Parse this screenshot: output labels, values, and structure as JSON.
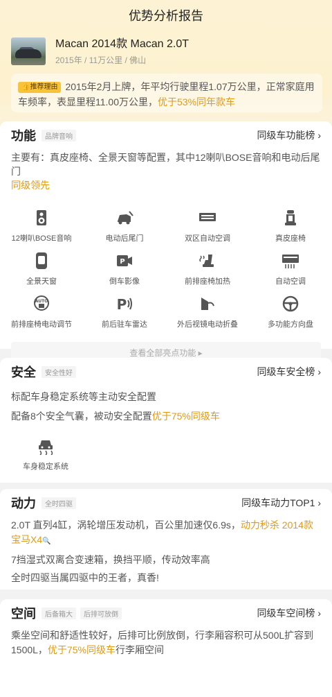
{
  "header": {
    "title": "优势分析报告"
  },
  "car": {
    "title": "Macan 2014款 Macan 2.0T",
    "meta": "2015年 / 11万公里 / 佛山",
    "image_icon": "car-photo"
  },
  "reason": {
    "badge": "推荐理由",
    "text": "2015年2月上牌，年平均行驶里程1.07万公里，正常家庭用车频率，表显里程11.00万公里，",
    "highlight": "优于53%同年款车"
  },
  "function": {
    "title": "功能",
    "tag": "品牌音响",
    "link": "同级车功能榜 ›",
    "summary": "主要有：真皮座椅、全景天窗等配置，其中12喇叭BOSE音响和电动后尾门",
    "summary_highlight": "同级领先",
    "features": [
      {
        "label": "12喇叭BOSE音响",
        "icon": "speaker-icon"
      },
      {
        "label": "电动后尾门",
        "icon": "tailgate-icon"
      },
      {
        "label": "双区自动空调",
        "icon": "ac-icon"
      },
      {
        "label": "真皮座椅",
        "icon": "seat-icon"
      },
      {
        "label": "全景天窗",
        "icon": "sunroof-icon"
      },
      {
        "label": "倒车影像",
        "icon": "camera-icon"
      },
      {
        "label": "前排座椅加热",
        "icon": "seat-heat-icon"
      },
      {
        "label": "自动空调",
        "icon": "auto-ac-icon"
      },
      {
        "label": "前排座椅电动调节",
        "icon": "seat-adjust-icon"
      },
      {
        "label": "前后驻车雷达",
        "icon": "parking-radar-icon"
      },
      {
        "label": "外后视镜电动折叠",
        "icon": "mirror-icon"
      },
      {
        "label": "多功能方向盘",
        "icon": "steering-icon"
      }
    ],
    "see_all": "查看全部亮点功能 ▸"
  },
  "safety": {
    "title": "安全",
    "tag": "安全性好",
    "link": "同级车安全榜 ›",
    "line1": "标配车身稳定系统等主动安全配置",
    "line2": "配备8个安全气囊，被动安全配置",
    "line2_highlight": "优于75%同级车",
    "feature": {
      "label": "车身稳定系统",
      "icon": "esp-icon"
    }
  },
  "power": {
    "title": "动力",
    "tag": "全时四驱",
    "link": "同级车动力TOP1 ›",
    "line1": "2.0T 直列4缸，涡轮增压发动机，百公里加速仅6.9s，",
    "line1_highlight": "动力秒杀 2014款宝马X4",
    "line2": "7挡湿式双离合变速箱，换挡平顺，传动效率高",
    "line3": "全时四驱当属四驱中的王者，真香!"
  },
  "space": {
    "title": "空间",
    "tags": [
      "后备箱大",
      "后排可放倒"
    ],
    "link": "同级车空间榜 ›",
    "text": "乘坐空间和舒适性较好，后排可比例放倒，行李厢容积可从500L扩容到1500L，",
    "highlight": "优于75%同级车",
    "text_tail": "行李厢空间"
  },
  "colors": {
    "accent": "#e29a14",
    "badge": "#f8c338"
  }
}
